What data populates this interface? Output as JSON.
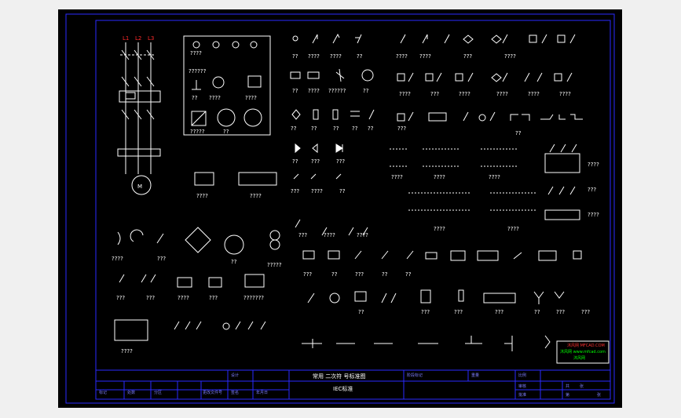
{
  "colors": {
    "background": "#000000",
    "frame": "#2a2aff",
    "symbol": "#ffffff",
    "terminal": "#ff2a2a",
    "stamp_border": "#ffffff",
    "stamp_green": "#00ff00",
    "stamp_red": "#ff3030"
  },
  "labels": {
    "q": "??",
    "q3": "???",
    "q4": "????",
    "q5": "?????",
    "q6": "??????",
    "q7": "???????"
  },
  "terminals": [
    "L1",
    "L2",
    "L3"
  ],
  "title_block": {
    "title": "常用 二次符 号标准图",
    "subtitle": "IEC标准",
    "cells": [
      "标记",
      "处数",
      "分区",
      "更改文件号",
      "签名",
      "年月日",
      "设计",
      "标准化",
      "阶段标记",
      "重量",
      "比例",
      "审核",
      "工艺",
      "批准",
      "共",
      "张",
      "第",
      "张"
    ]
  },
  "stamp": {
    "line1": "沐风网 MFCAD.COM",
    "line2": "沐风网 www.mfcad.com",
    "line3": "沐风网"
  }
}
